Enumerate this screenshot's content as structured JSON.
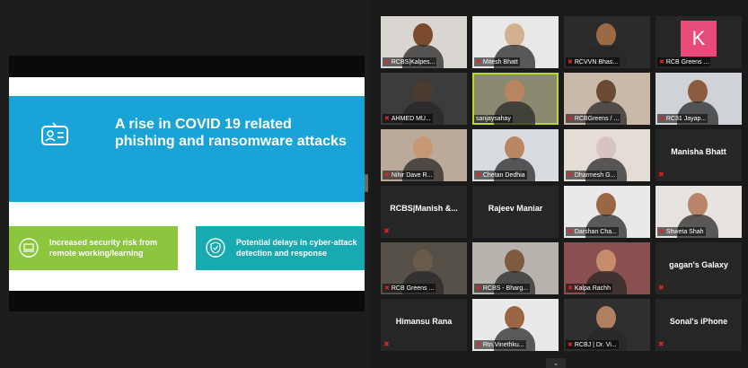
{
  "slide": {
    "title": "A rise in COVID 19 related phishing and ransomware attacks",
    "card_left": "Increased security risk from remote working/learning",
    "card_right": "Potential delays in cyber-attack detection and response",
    "colors": {
      "banner": "#1aa3d6",
      "card_left": "#8cc63f",
      "card_right": "#17aab0"
    }
  },
  "participants": [
    {
      "label": "RCBS|Kalpes...",
      "type": "video",
      "bg": "#d9d6d2",
      "skin": "#7a4a2e",
      "muted": true,
      "active": false
    },
    {
      "label": "Mitesh Bhatt",
      "type": "video",
      "bg": "#e8e8e8",
      "skin": "#d3b08f",
      "muted": true,
      "active": false
    },
    {
      "label": "RCVVN Bhas...",
      "type": "video",
      "bg": "#2b2b2b",
      "skin": "#9a6a45",
      "muted": true,
      "active": false
    },
    {
      "label": "RCB Greens ...",
      "type": "avatar",
      "initial": "K",
      "bg": "#e84a7a",
      "muted": true,
      "active": false
    },
    {
      "label": "AHMED MU...",
      "type": "video",
      "bg": "#3b3b3b",
      "skin": "#4a3a30",
      "muted": true,
      "active": false
    },
    {
      "label": "sanjaysahay",
      "type": "video",
      "bg": "#8a8a70",
      "skin": "#b98560",
      "muted": false,
      "active": true
    },
    {
      "label": "RCBGreens / ...",
      "type": "video",
      "bg": "#c9b9a8",
      "skin": "#6b4a34",
      "muted": true,
      "active": false
    },
    {
      "label": "RC31 Jayap...",
      "type": "video",
      "bg": "#cfd3d8",
      "skin": "#8d5c3e",
      "muted": true,
      "active": false
    },
    {
      "label": "Nihir Dave R...",
      "type": "video",
      "bg": "#bba999",
      "skin": "#c69874",
      "muted": true,
      "active": false
    },
    {
      "label": "Chetan Dedhia",
      "type": "video",
      "bg": "#d8dbe0",
      "skin": "#b98862",
      "muted": true,
      "active": false
    },
    {
      "label": "Dharmesh G...",
      "type": "video",
      "bg": "#e4ddd5",
      "skin": "#d9c2c2",
      "muted": true,
      "active": false
    },
    {
      "label": "Manisha Bhatt",
      "type": "name",
      "muted": true,
      "active": false
    },
    {
      "label": "RCBS|Manish &...",
      "type": "name",
      "muted": true,
      "active": false
    },
    {
      "label": "Rajeev Maniar",
      "type": "name",
      "muted": false,
      "active": false
    },
    {
      "label": "Darshan Cha...",
      "type": "video",
      "bg": "#e9e9e9",
      "skin": "#9a6744",
      "muted": true,
      "active": false
    },
    {
      "label": "Shweta Shah",
      "type": "video",
      "bg": "#e6e3e0",
      "skin": "#b98467",
      "muted": true,
      "active": false
    },
    {
      "label": "RCB Greens ...",
      "type": "video",
      "bg": "#555048",
      "skin": "#6a5a4a",
      "muted": true,
      "active": false
    },
    {
      "label": "RCBS - Bharg...",
      "type": "video",
      "bg": "#b7b4ad",
      "skin": "#7d5a40",
      "muted": true,
      "active": false
    },
    {
      "label": "Kalpa Rachh",
      "type": "video",
      "bg": "#8a4f4f",
      "skin": "#c58d6c",
      "muted": true,
      "active": false
    },
    {
      "label": "gagan's Galaxy",
      "type": "name",
      "muted": true,
      "active": false
    },
    {
      "label": "Himansu Rana",
      "type": "name",
      "muted": true,
      "active": false
    },
    {
      "label": "Rtn.Vinethku...",
      "type": "video",
      "bg": "#e9e9e9",
      "skin": "#9a6644",
      "muted": true,
      "active": false
    },
    {
      "label": "RCBJ | Dr. Vi...",
      "type": "video",
      "bg": "#2f2f2f",
      "skin": "#b08060",
      "muted": true,
      "active": false
    },
    {
      "label": "Sonal's iPhone",
      "type": "name",
      "muted": true,
      "active": false
    }
  ],
  "icons": {
    "mic_muted": "mic-muted-icon",
    "scroll": "chevron-down-icon"
  }
}
